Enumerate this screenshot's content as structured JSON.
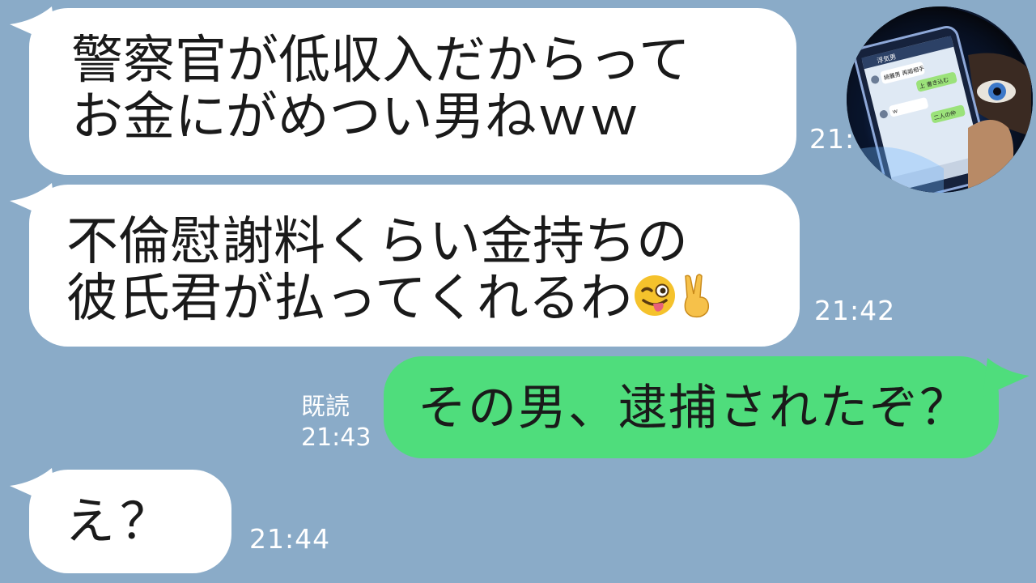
{
  "messages": [
    {
      "side": "left",
      "lines": [
        "警察官が低収入だからって",
        "お金にがめつい男ねｗｗ"
      ],
      "time": "21:"
    },
    {
      "side": "left",
      "lines": [
        "不倫慰謝料くらい金持ちの",
        "彼氏君が払ってくれるわ"
      ],
      "emojis": [
        "winking-tongue-face",
        "victory-hand"
      ],
      "time": "21:42"
    },
    {
      "side": "right",
      "lines": [
        "その男、逮捕されたぞ？"
      ],
      "read_label": "既読",
      "time": "21:43"
    },
    {
      "side": "left",
      "lines": [
        "え？"
      ],
      "time": "21:44"
    }
  ],
  "avatar": {
    "icon": "hooded-person-holding-phone",
    "phone_labels": [
      "浮気男",
      "綺麗男 再婚相手",
      "上 書き込む",
      "ｗ",
      "二人の仲"
    ]
  },
  "colors": {
    "background": "#8aabc8",
    "left_bubble": "#ffffff",
    "right_bubble": "#4fdd7c",
    "text": "#1a1a1a",
    "meta_text": "#ffffff"
  }
}
